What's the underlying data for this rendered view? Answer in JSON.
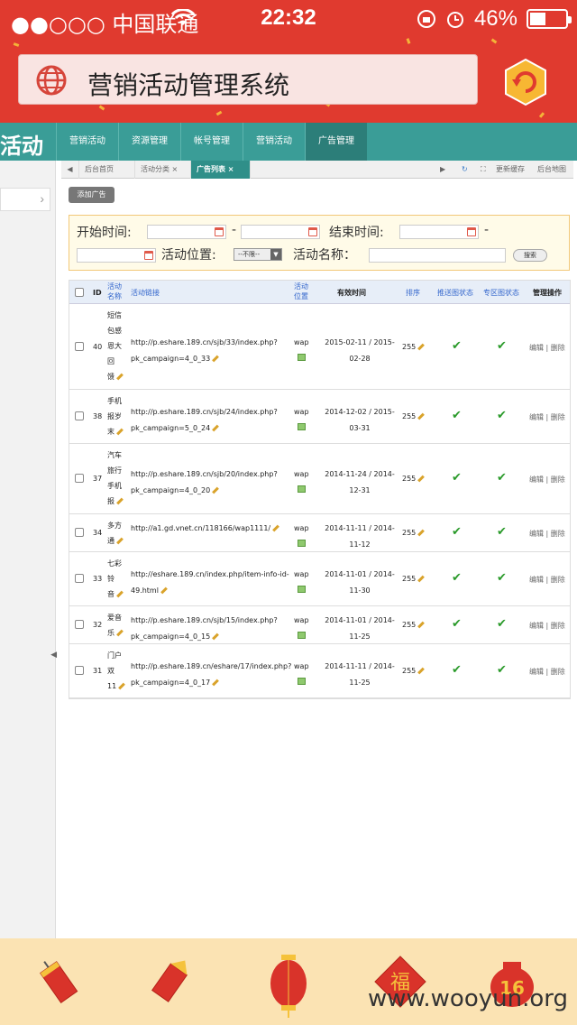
{
  "status": {
    "carrier": "●●○○○ 中国联通",
    "time": "22:32",
    "battery": "46%",
    "battery_level": 0.46
  },
  "browser": {
    "title": "营销活动管理系统"
  },
  "header": {
    "brand": "活动",
    "tabs": [
      "营销活动",
      "资源管理",
      "帐号管理",
      "营销活动",
      "广告管理"
    ],
    "active_tab": 4
  },
  "tabstrip": {
    "tabs": [
      {
        "label": "后台首页"
      },
      {
        "label": "活动分类"
      },
      {
        "label": "广告列表"
      }
    ],
    "refresh_label": "更新缓存",
    "map_label": "后台地图"
  },
  "toolbar": {
    "add_label": "添加广告"
  },
  "filter": {
    "start_label": "开始时间:",
    "end_label": "结束时间:",
    "dash": "-",
    "position_label": "活动位置:",
    "position_value": "--不限--",
    "name_label": "活动名称：",
    "search_label": "搜索"
  },
  "table": {
    "headers": {
      "id": "ID",
      "name": "活动\n名称",
      "link": "活动链接",
      "position": "活动\n位置",
      "time": "有效时间",
      "sort": "排序",
      "push": "推送图状态",
      "zone": "专区图状态",
      "ops": "管理操作"
    },
    "rows": [
      {
        "id": "40",
        "name": "短信\n包感\n恩大\n回\n馈",
        "link": "http://p.eshare.189.cn/sjb/33/index.php?\npk_campaign=4_0_33",
        "position": "wap",
        "time": "2015-02-11 / 2015-\n02-28",
        "sort": "255"
      },
      {
        "id": "38",
        "name": "手机\n报岁\n末",
        "link": "http://p.eshare.189.cn/sjb/24/index.php?\npk_campaign=5_0_24",
        "position": "wap",
        "time": "2014-12-02 / 2015-\n03-31",
        "sort": "255"
      },
      {
        "id": "37",
        "name": "汽车\n旅行\n手机\n报",
        "link": "http://p.eshare.189.cn/sjb/20/index.php?\npk_campaign=4_0_20",
        "position": "wap",
        "time": "2014-11-24 / 2014-\n12-31",
        "sort": "255"
      },
      {
        "id": "34",
        "name": "多方\n通",
        "link": "http://a1.gd.vnet.cn/118166/wap1111/",
        "position": "wap",
        "time": "2014-11-11 / 2014-\n11-12",
        "sort": "255"
      },
      {
        "id": "33",
        "name": "七彩\n铃\n音",
        "link": "http://eshare.189.cn/index.php/item-info-id-\n49.html",
        "position": "wap",
        "time": "2014-11-01 / 2014-\n11-30",
        "sort": "255"
      },
      {
        "id": "32",
        "name": "爱音\n乐",
        "link": "http://p.eshare.189.cn/sjb/15/index.php?\npk_campaign=4_0_15",
        "position": "wap",
        "time": "2014-11-01 / 2014-\n11-25",
        "sort": "255"
      },
      {
        "id": "31",
        "name": "门户\n双\n11",
        "link": "http://p.eshare.189.cn/eshare/17/index.php?\npk_campaign=4_0_17",
        "position": "wap",
        "time": "2014-11-11 / 2014-\n11-25",
        "sort": "255"
      }
    ],
    "ops_label": "编辑 | 删除"
  },
  "bottom": {
    "badge": "16",
    "fu": "福",
    "watermark": "www.wooyun.org"
  },
  "colors": {
    "topbar": "#e03a2f",
    "teal": "#3a9d97",
    "bottombar": "#fbe3b3"
  }
}
